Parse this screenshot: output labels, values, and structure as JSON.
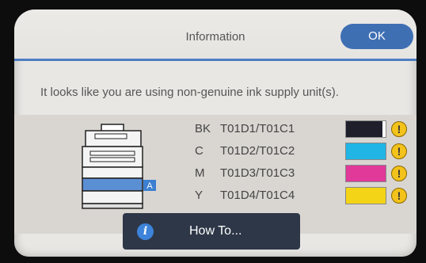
{
  "dialog": {
    "title": "Information",
    "ok_label": "OK",
    "message": "It looks like you are using non-genuine ink supply unit(s)."
  },
  "printer": {
    "tray_label": "A"
  },
  "inks": [
    {
      "label": "BK",
      "code": "T01D1/T01C1",
      "color": "#1e1f2b",
      "level": 0.92,
      "warning": "!"
    },
    {
      "label": "C",
      "code": "T01D2/T01C2",
      "color": "#21b5e6",
      "level": 1.0,
      "warning": "!"
    },
    {
      "label": "M",
      "code": "T01D3/T01C3",
      "color": "#e0399a",
      "level": 1.0,
      "warning": "!"
    },
    {
      "label": "Y",
      "code": "T01D4/T01C4",
      "color": "#f3d416",
      "level": 1.0,
      "warning": "!"
    }
  ],
  "howto": {
    "label": "How To...",
    "icon_glyph": "i"
  }
}
